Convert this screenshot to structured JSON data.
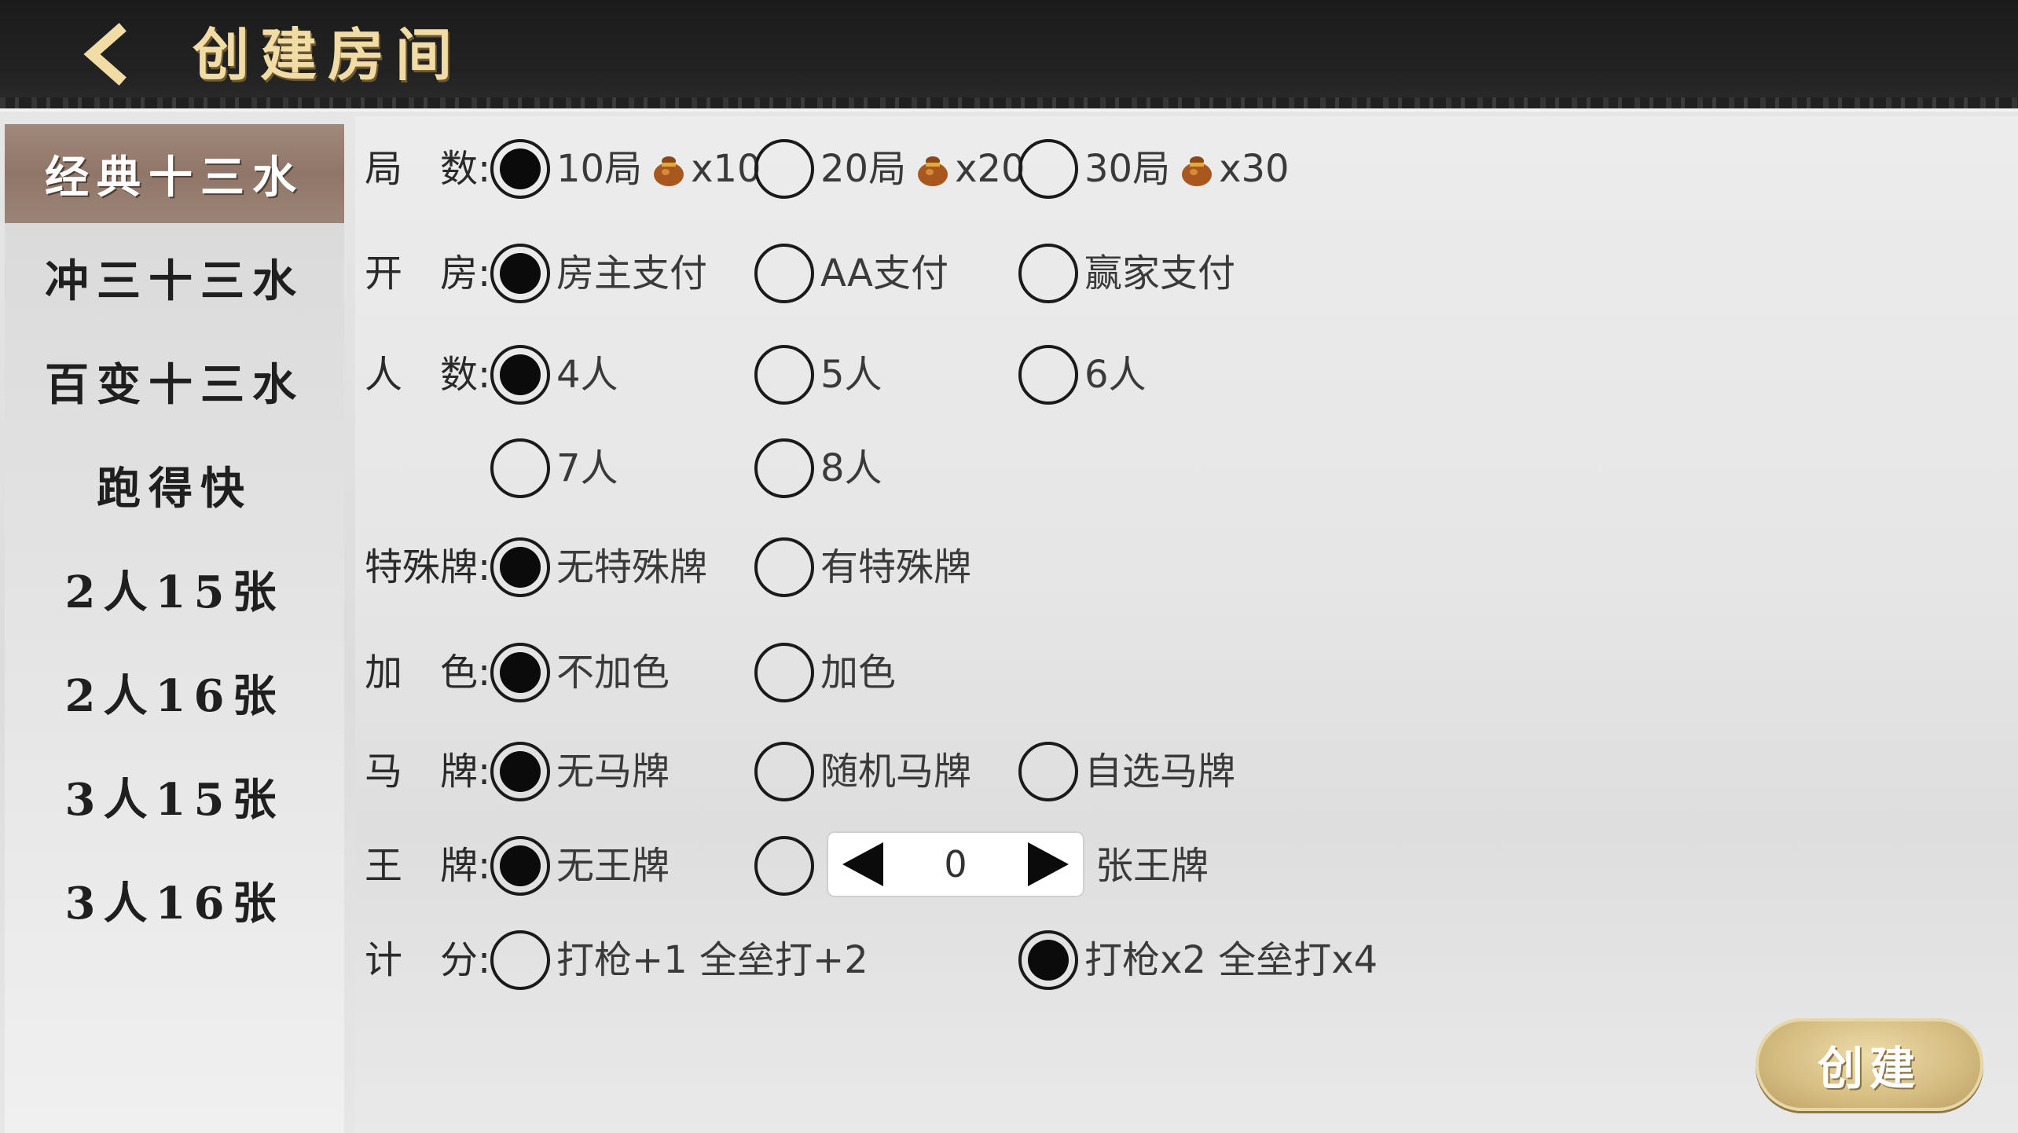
{
  "header": {
    "title": "创建房间",
    "back_icon": "chevron-left-icon"
  },
  "sidebar": {
    "items": [
      {
        "label": "经典十三水",
        "active": true
      },
      {
        "label": "冲三十三水",
        "active": false
      },
      {
        "label": "百变十三水",
        "active": false
      },
      {
        "label": "跑得快",
        "active": false
      },
      {
        "label": "2人15张",
        "active": false
      },
      {
        "label": "2人16张",
        "active": false
      },
      {
        "label": "3人15张",
        "active": false
      },
      {
        "label": "3人16张",
        "active": false
      }
    ]
  },
  "options": {
    "rounds": {
      "label": "局　数:",
      "choices": [
        {
          "text": "10局",
          "cost": "x10",
          "selected": true
        },
        {
          "text": "20局",
          "cost": "x20",
          "selected": false
        },
        {
          "text": "30局",
          "cost": "x30",
          "selected": false
        }
      ]
    },
    "payment": {
      "label": "开　房:",
      "choices": [
        {
          "text": "房主支付",
          "selected": true
        },
        {
          "text": "AA支付",
          "selected": false
        },
        {
          "text": "赢家支付",
          "selected": false
        }
      ]
    },
    "players": {
      "label": "人　数:",
      "choices": [
        {
          "text": "4人",
          "selected": true
        },
        {
          "text": "5人",
          "selected": false
        },
        {
          "text": "6人",
          "selected": false
        },
        {
          "text": "7人",
          "selected": false
        },
        {
          "text": "8人",
          "selected": false
        }
      ]
    },
    "special": {
      "label": "特殊牌:",
      "choices": [
        {
          "text": "无特殊牌",
          "selected": true
        },
        {
          "text": "有特殊牌",
          "selected": false
        }
      ]
    },
    "color": {
      "label": "加　色:",
      "choices": [
        {
          "text": "不加色",
          "selected": true
        },
        {
          "text": "加色",
          "selected": false
        }
      ]
    },
    "horse": {
      "label": "马　牌:",
      "choices": [
        {
          "text": "无马牌",
          "selected": true
        },
        {
          "text": "随机马牌",
          "selected": false
        },
        {
          "text": "自选马牌",
          "selected": false
        }
      ]
    },
    "king": {
      "label": "王　牌:",
      "choices": [
        {
          "text": "无王牌",
          "selected": true
        },
        {
          "text": "",
          "selected": false
        }
      ],
      "count": "0",
      "suffix": "张王牌"
    },
    "scoring": {
      "label": "计　分:",
      "choices": [
        {
          "text": "打枪+1 全垒打+2",
          "selected": false
        },
        {
          "text": "打枪x2 全垒打x4",
          "selected": true
        }
      ]
    }
  },
  "create_button": {
    "label": "创建"
  },
  "colors": {
    "header_bg": "#1b1b1b",
    "title": "#f2dca6",
    "active_tab": "#9c8477",
    "create_button": "#d6bd82"
  }
}
